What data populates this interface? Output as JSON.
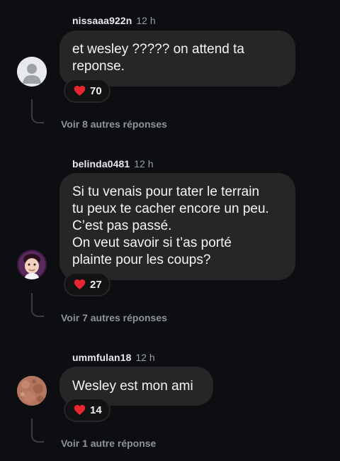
{
  "comments": [
    {
      "username": "nissaaa922n",
      "time": "12 h",
      "text_lines": [
        "et wesley ????? on attend ta",
        "reponse."
      ],
      "reaction_count": "70",
      "more_replies": "Voir 8 autres réponses",
      "avatar": "default-user-icon"
    },
    {
      "username": "belinda0481",
      "time": "12 h",
      "text_lines": [
        "Si tu venais pour tater le terrain",
        "tu peux te cacher encore un peu.",
        "C’est pas passé.",
        "On veut savoir si t’as porté",
        "plainte pour les coups?"
      ],
      "reaction_count": "27",
      "more_replies": "Voir 7 autres réponses",
      "avatar": "baby-photo"
    },
    {
      "username": "ummfulan18",
      "time": "12 h",
      "text_lines": [
        "Wesley est mon ami"
      ],
      "reaction_count": "14",
      "more_replies": "Voir 1 autre réponse",
      "avatar": "brown-texture-photo"
    }
  ],
  "colors": {
    "heart": "#e8262f",
    "bubble": "#262626",
    "background": "#0c0e12"
  }
}
